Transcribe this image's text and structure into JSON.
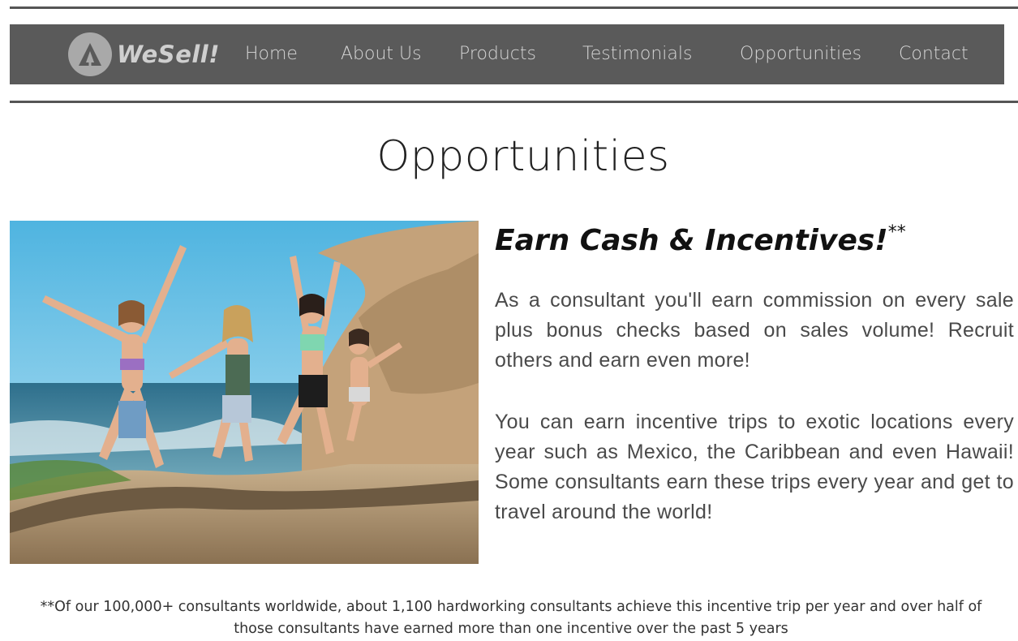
{
  "brand": {
    "name": "WeSell!"
  },
  "nav": {
    "items": [
      {
        "label": "Home"
      },
      {
        "label": "About Us"
      },
      {
        "label": "Products"
      },
      {
        "label": "Testimonials"
      },
      {
        "label": "Opportunities"
      },
      {
        "label": "Contact"
      }
    ]
  },
  "page": {
    "title": "Opportunities"
  },
  "content": {
    "headline": "Earn Cash & Incentives!",
    "headline_mark": "**",
    "paragraph1": "As a consultant you'll earn commission on every sale plus bonus checks based on sales volume! Recruit others and earn even more!",
    "paragraph2": "You can earn incentive trips to exotic locations every year such as Mexico, the Caribbean and even Hawaii! Some consultants earn these trips every year and get to travel around the world!"
  },
  "footnote": {
    "text": "**Of our 100,000+ consultants worldwide, about 1,100 hardworking consultants achieve this incentive trip per year and over half of those consultants have earned more than one incentive over the past 5 years"
  },
  "colors": {
    "navbar": "#5a5a5a",
    "nav_text": "#d6d6d6",
    "logo_circle": "#a9a9a9"
  }
}
